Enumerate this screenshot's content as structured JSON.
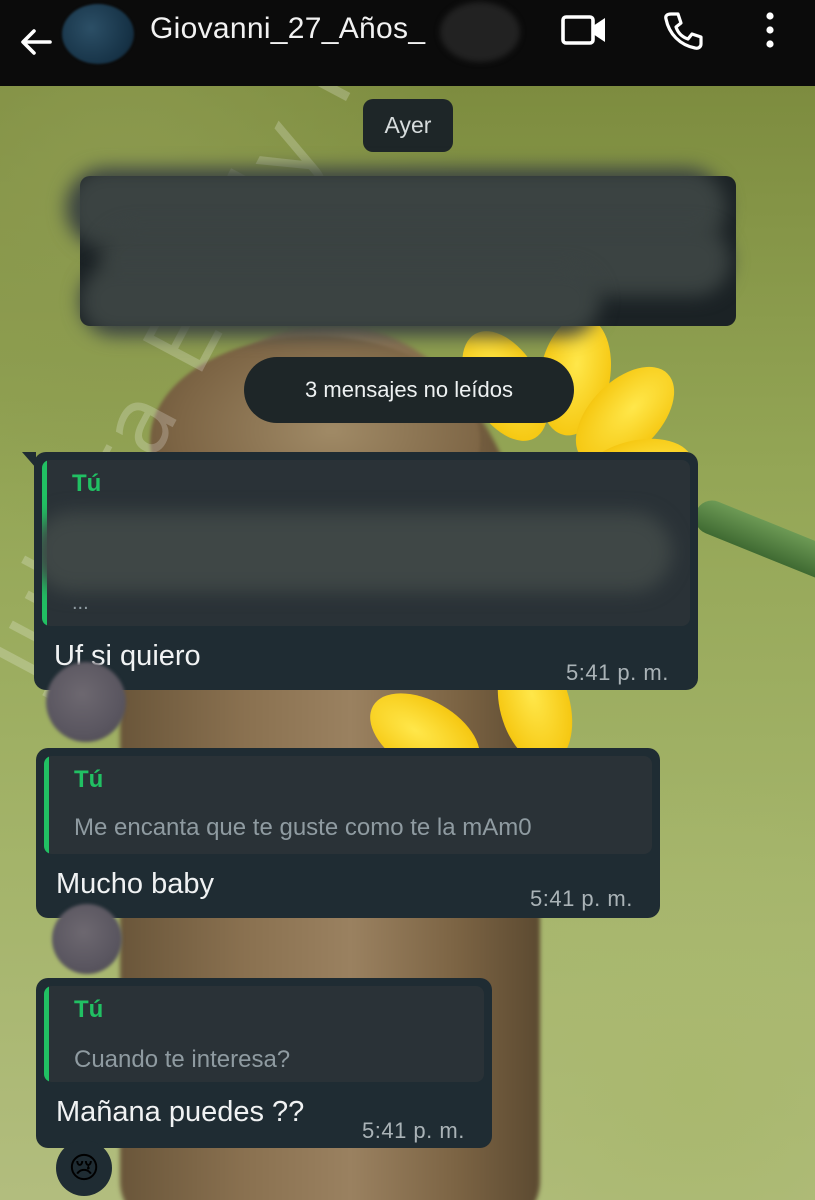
{
  "header": {
    "contact_name": "Giovanni_27_Años_",
    "icons": [
      "back-arrow-icon",
      "video-call-icon",
      "phone-icon",
      "more-vert-icon"
    ]
  },
  "date_chip": "Ayer",
  "unread_chip": "3 mensajes no leídos",
  "watermark": "Julieta Emily Rico Gómez",
  "messages": [
    {
      "quote_sender": "Tú",
      "quote_text": "...",
      "text": "Uf si quiero",
      "time": "5:41 p. m."
    },
    {
      "quote_sender": "Tú",
      "quote_text": "Me encanta que te guste como te la mAm0",
      "text": "Mucho baby",
      "time": "5:41 p. m."
    },
    {
      "quote_sender": "Tú",
      "quote_text": "Cuando te interesa?",
      "text": "Mañana puedes ??",
      "time": "5:41 p. m.",
      "reaction": "😢"
    }
  ],
  "colors": {
    "header_bg": "#0b0b0b",
    "bubble_bg": "#1f2c33",
    "quote_accent": "#21c063"
  }
}
